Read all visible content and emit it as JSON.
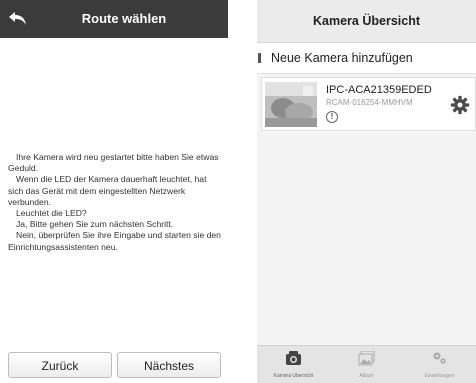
{
  "left_screen": {
    "header": {
      "title": "Route wählen"
    },
    "message": [
      "Ihre Kamera wird neu gestartet bitte haben Sie etwas Geduld.",
      "Wenn die LED der Kamera dauerhaft leuchtet, hat sich das Gerät mit dem eingestellten Netzwerk verbunden.",
      "Leuchtet die LED?",
      "Ja, Bitte gehen Sie zum nächsten Schritt.",
      "Nein, überprüfen Sie ihre Eingabe und starten sie den Einrichtungsassistenten neu."
    ],
    "buttons": {
      "back": "Zurück",
      "next": "Nächstes"
    }
  },
  "right_screen": {
    "header": {
      "title": "Kamera Übersicht"
    },
    "add_camera": "Neue Kamera hinzufügen",
    "camera": {
      "name": "IPC-ACA21359EDED",
      "id": "RCAM-016254-MMHVM",
      "warning": "!"
    },
    "tabs": [
      {
        "label": "Kamera Übersicht",
        "icon": "camera-icon"
      },
      {
        "label": "Album",
        "icon": "album-icon"
      },
      {
        "label": "Einstellungen",
        "icon": "settings-icon"
      }
    ]
  },
  "colors": {
    "header_dark": "#3b3b3b",
    "header_light": "#ebebeb",
    "tabbar": "#e4e4e4"
  }
}
